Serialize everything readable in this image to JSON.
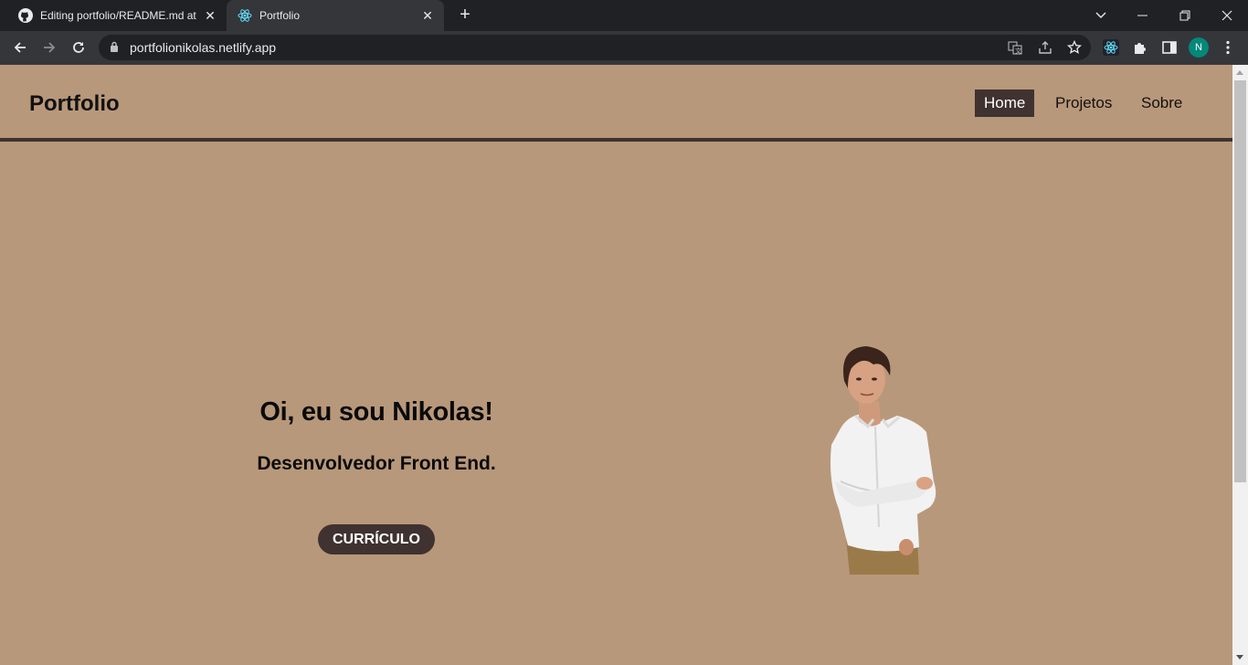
{
  "browser": {
    "tabs": [
      {
        "title": "Editing portfolio/README.md at",
        "icon": "github-icon",
        "active": false
      },
      {
        "title": "Portfolio",
        "icon": "react-icon",
        "active": true
      }
    ],
    "address": "portfolionikolas.netlify.app",
    "profile_initial": "N"
  },
  "site": {
    "brand": "Portfolio",
    "nav": [
      {
        "label": "Home",
        "active": true
      },
      {
        "label": "Projetos",
        "active": false
      },
      {
        "label": "Sobre",
        "active": false
      }
    ],
    "hero": {
      "title": "Oi, eu sou Nikolas!",
      "subtitle": "Desenvolvedor Front End.",
      "button": "CURRÍCULO"
    }
  },
  "colors": {
    "background": "#b8987a",
    "accent": "#3f3230",
    "chrome_dark": "#202124",
    "chrome_toolbar": "#35363a"
  }
}
